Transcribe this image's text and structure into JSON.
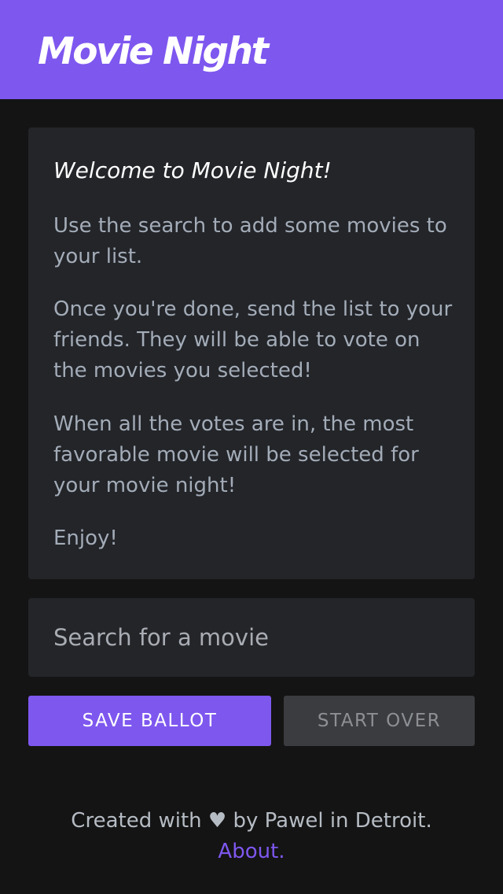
{
  "header": {
    "title": "Movie Night",
    "accent_color": "#7e57ef"
  },
  "welcome": {
    "heading": "Welcome to Movie Night!",
    "paragraphs": [
      "Use the search to add some movies to your list.",
      "Once you're done, send the list to your friends. They will be able to vote on the movies you selected!",
      "When all the votes are in, the most favorable movie will be selected for your movie night!",
      "Enjoy!"
    ]
  },
  "search": {
    "placeholder": "Search for a movie",
    "value": ""
  },
  "actions": {
    "save_label": "Save Ballot",
    "start_over_label": "Start Over"
  },
  "footer": {
    "credit_prefix": "Created with",
    "heart_glyph": "♥",
    "credit_suffix": "by Pawel in Detroit.",
    "about_label": "About."
  }
}
